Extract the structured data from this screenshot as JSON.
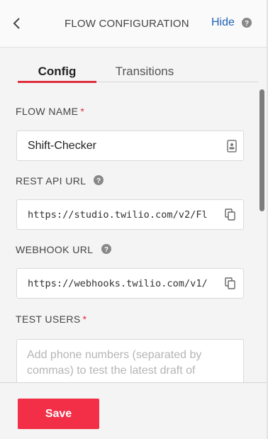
{
  "header": {
    "title": "FLOW CONFIGURATION",
    "hide_label": "Hide",
    "back_icon": "chevron-left-icon",
    "help_icon": "question-circle-icon"
  },
  "tabs": [
    {
      "label": "Config",
      "active": true
    },
    {
      "label": "Transitions",
      "active": false
    }
  ],
  "fields": {
    "flow_name": {
      "label": "FLOW NAME",
      "required": "*",
      "value": "Shift-Checker",
      "icon": "contact-card-icon"
    },
    "rest_api_url": {
      "label": "REST API URL",
      "value": "https://studio.twilio.com/v2/Fl",
      "icon": "copy-icon"
    },
    "webhook_url": {
      "label": "WEBHOOK URL",
      "value": "https://webhooks.twilio.com/v1/",
      "icon": "copy-icon"
    },
    "test_users": {
      "label": "TEST USERS",
      "required": "*",
      "placeholder": "Add phone numbers (separated by commas) to test the latest draft of"
    }
  },
  "footer": {
    "save_label": "Save"
  },
  "colors": {
    "accent": "#f22f46",
    "link": "#1f62b5",
    "required": "#e02e3d"
  }
}
